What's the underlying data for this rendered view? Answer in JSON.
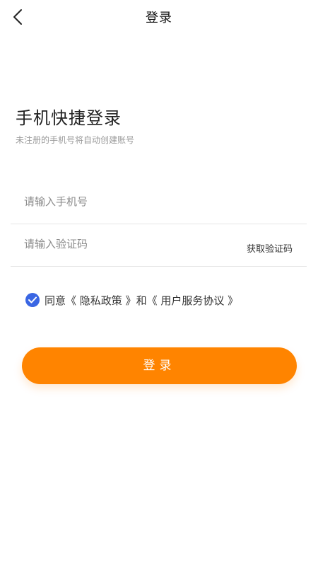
{
  "nav": {
    "title": "登录",
    "back_icon": "chevron-left-icon"
  },
  "heading": "手机快捷登录",
  "subheading": "未注册的手机号将自动创建账号",
  "phone_field": {
    "value": "",
    "placeholder": "请输入手机号"
  },
  "code_field": {
    "value": "",
    "placeholder": "请输入验证码",
    "get_code_label": "获取验证码"
  },
  "agreement": {
    "checked": true,
    "check_icon": "checkmark-circle-icon",
    "prefix": "同意",
    "privacy_link": "《 隐私政策 》",
    "conjunction": "和",
    "terms_link": "《 用户服务协议 》"
  },
  "login_button": {
    "label": "登录"
  },
  "colors": {
    "accent": "#ff8400",
    "check": "#3a66e3",
    "placeholder": "#8c8c8c",
    "divider": "#e6e6e6"
  }
}
